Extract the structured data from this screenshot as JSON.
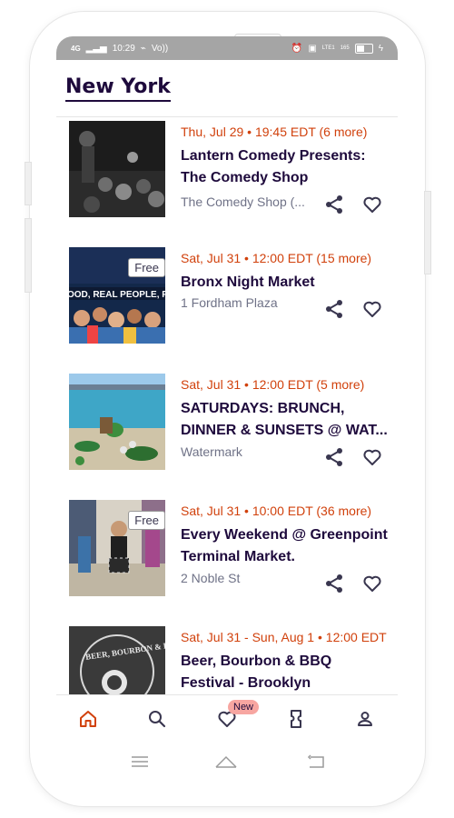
{
  "status": {
    "time": "10:29",
    "signal": "4G",
    "volte": "Vo))",
    "lte": "LTE1",
    "speed": "165\nB/s"
  },
  "header": {
    "city": "New York"
  },
  "events": [
    {
      "date": "Thu, Jul 29 • 19:45 EDT (6 more)",
      "title": "Lantern Comedy Presents: The Comedy Shop",
      "venue": "The Comedy Shop (...",
      "free": ""
    },
    {
      "date": "Sat, Jul 31 • 12:00 EDT (15 more)",
      "title": "Bronx Night Market",
      "venue": "1 Fordham Plaza",
      "free": "Free",
      "banner": "OOD, REAL PEOPLE, R"
    },
    {
      "date": "Sat, Jul 31 • 12:00 EDT (5 more)",
      "title": "SATURDAYS: BRUNCH, DINNER & SUNSETS @ WAT...",
      "venue": "Watermark",
      "free": ""
    },
    {
      "date": "Sat, Jul 31 • 10:00 EDT (36 more)",
      "title": "Every Weekend @ Greenpoint Terminal Market.",
      "venue": "2 Noble St",
      "free": "Free"
    },
    {
      "date": "Sat, Jul 31 - Sun, Aug 1 • 12:00 EDT",
      "title": "Beer, Bourbon & BBQ Festival - Brooklyn",
      "venue": "",
      "free": "",
      "banner": "BEER, BOURBON & BBQ"
    }
  ],
  "tabs": {
    "new_badge": "New"
  },
  "colors": {
    "accent": "#d1410c",
    "title": "#1e0a3c",
    "muted": "#6f7287",
    "badge": "#f7a6a1"
  }
}
